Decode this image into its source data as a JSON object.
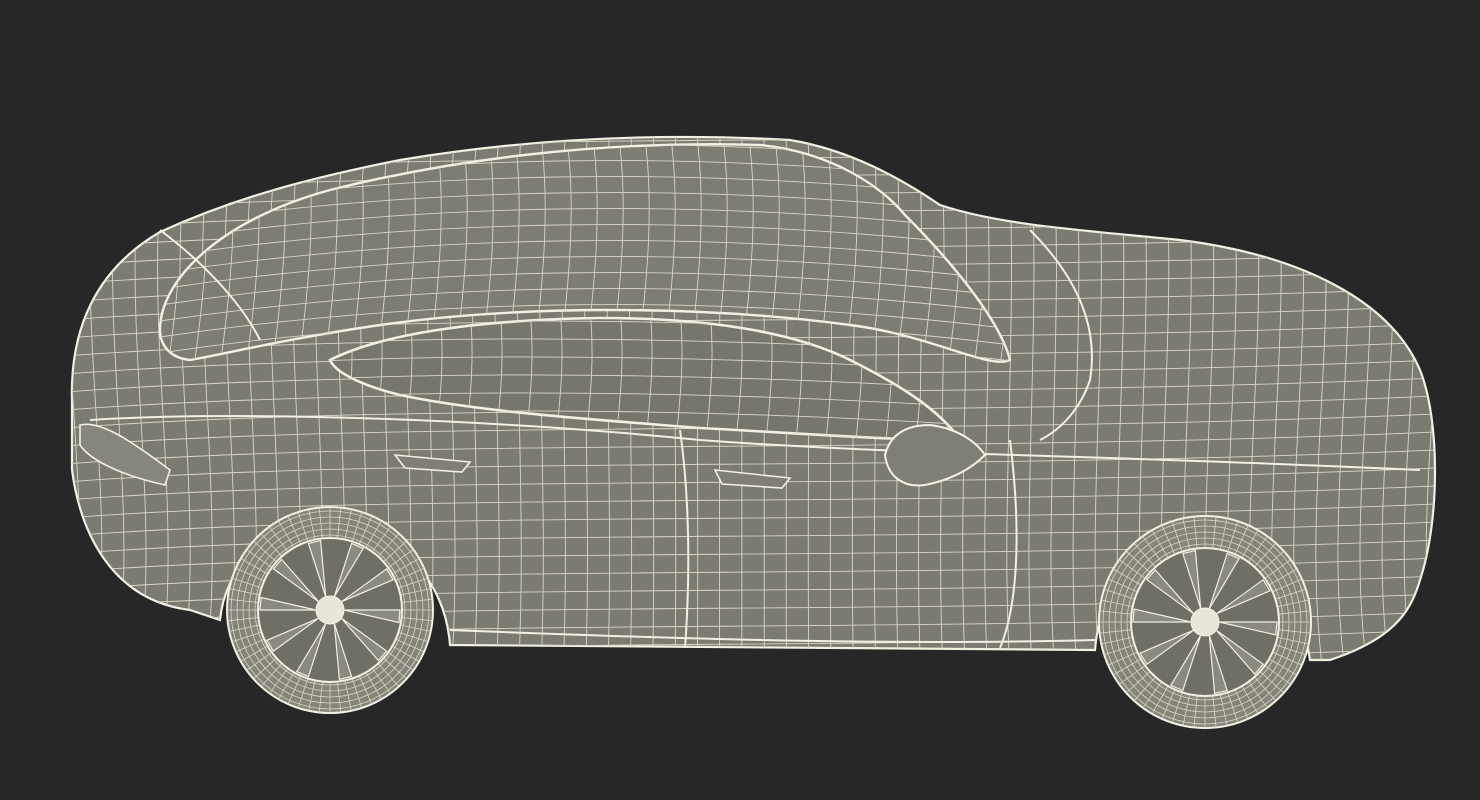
{
  "scene": {
    "background_color": "#272727",
    "model_fill_color": "#7b7b72",
    "model_shade_color": "#6a6a62",
    "wire_color": "#f2f0e2",
    "wire_dim_color": "#d8d6c6",
    "tire_color": "#848479",
    "hub_color": "#e8e6d8",
    "render_mode": "wireframe",
    "subject": "car-model"
  }
}
